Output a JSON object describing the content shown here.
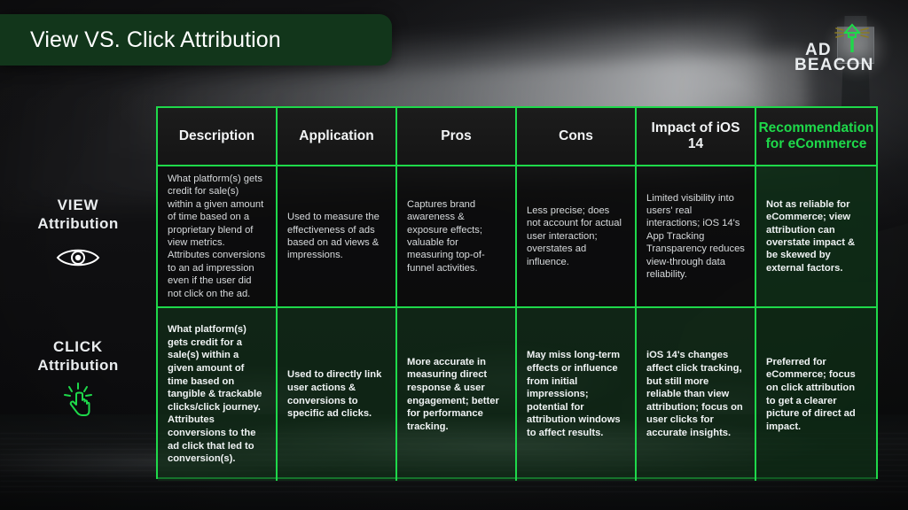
{
  "title": "View VS. Click Attribution",
  "logo": {
    "line1": "AD",
    "line2": "BEACON",
    "icon": "lighthouse-icon",
    "accent_color": "#1ed94a"
  },
  "theme": {
    "border_green": "#1ed94a",
    "banner_green": "#12361b",
    "text_light": "#e9ecee",
    "background": "#0c0c0c"
  },
  "row_labels": [
    {
      "id": "view",
      "line1": "VIEW",
      "line2": "Attribution",
      "icon": "eye-icon",
      "icon_color": "#ffffff"
    },
    {
      "id": "click",
      "line1": "CLICK",
      "line2": "Attribution",
      "icon": "click-hand-icon",
      "icon_color": "#1ed94a"
    }
  ],
  "table": {
    "headers": [
      {
        "label": "Description",
        "highlight": false
      },
      {
        "label": "Application",
        "highlight": false
      },
      {
        "label": "Pros",
        "highlight": false
      },
      {
        "label": "Cons",
        "highlight": false
      },
      {
        "label": "Impact of iOS 14",
        "highlight": false
      },
      {
        "label": "Recommendation for eCommerce",
        "highlight": true
      }
    ],
    "rows": [
      {
        "id": "view",
        "cells": [
          "What platform(s) gets credit for sale(s) within a given amount of time based on a proprietary blend of view metrics. Attributes conversions to an ad impression even if the user did not click on the ad.",
          "Used to measure the effectiveness of ads based on ad views & impressions.",
          "Captures brand awareness & exposure effects; valuable for measuring top-of-funnel activities.",
          "Less precise; does not account for actual user interaction; overstates ad influence.",
          "Limited visibility into users' real interactions; iOS 14's App Tracking Transparency reduces view-through data reliability.",
          "Not as reliable for eCommerce; view attribution can overstate impact & be skewed by external factors."
        ]
      },
      {
        "id": "click",
        "cells": [
          "What platform(s) gets credit for a sale(s)  within a given amount of time based on tangible & trackable clicks/click journey. Attributes conversions to the ad click that led to conversion(s).",
          "Used to directly link user actions & conversions to specific ad clicks.",
          "More accurate in measuring direct response & user engagement; better for performance tracking.",
          "May miss long-term effects or influence from initial impressions; potential for attribution windows to affect results.",
          "iOS 14's changes affect click tracking, but still more reliable than view attribution; focus on user clicks for accurate insights.",
          "Preferred for eCommerce; focus on click attribution to get a clearer picture of direct ad impact."
        ]
      }
    ]
  }
}
